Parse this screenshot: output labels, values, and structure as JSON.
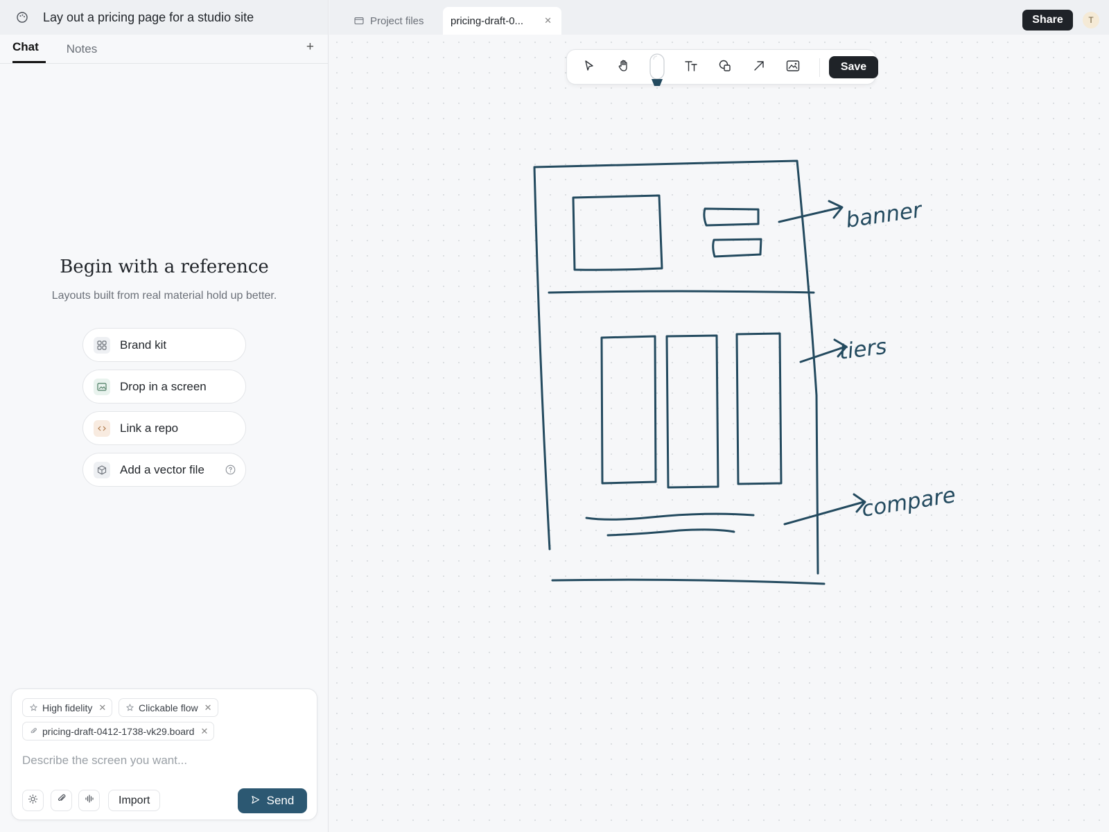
{
  "project": {
    "title": "Lay out a pricing page for a studio site"
  },
  "left_tabs": [
    "Chat",
    "Notes"
  ],
  "hero": {
    "title": "Begin with a reference",
    "subtitle": "Layouts built from real material hold up better."
  },
  "options": [
    {
      "label": "Brand kit",
      "icon": "grid-icon",
      "color": "#eef0f3"
    },
    {
      "label": "Drop in a screen",
      "icon": "image-icon",
      "color": "#e9f3ee"
    },
    {
      "label": "Link a repo",
      "icon": "code-icon",
      "color": "#f8ebe0"
    },
    {
      "label": "Add a vector file",
      "icon": "cube-icon",
      "color": "#eef0f3"
    }
  ],
  "composer": {
    "chips": [
      "High fidelity",
      "Clickable flow"
    ],
    "attachment": "pricing-draft-0412-1738-vk29.board",
    "placeholder": "Describe the screen you want...",
    "import_label": "Import",
    "send_label": "Send"
  },
  "topbar": {
    "project_files_label": "Project files",
    "active_file_label": "pricing-draft-0...",
    "share_label": "Share",
    "avatar_initial": "T"
  },
  "toolbar": {
    "save_label": "Save"
  },
  "sketch": {
    "labels": [
      "banner",
      "tiers",
      "compare"
    ],
    "stroke_color": "#234a5f"
  }
}
